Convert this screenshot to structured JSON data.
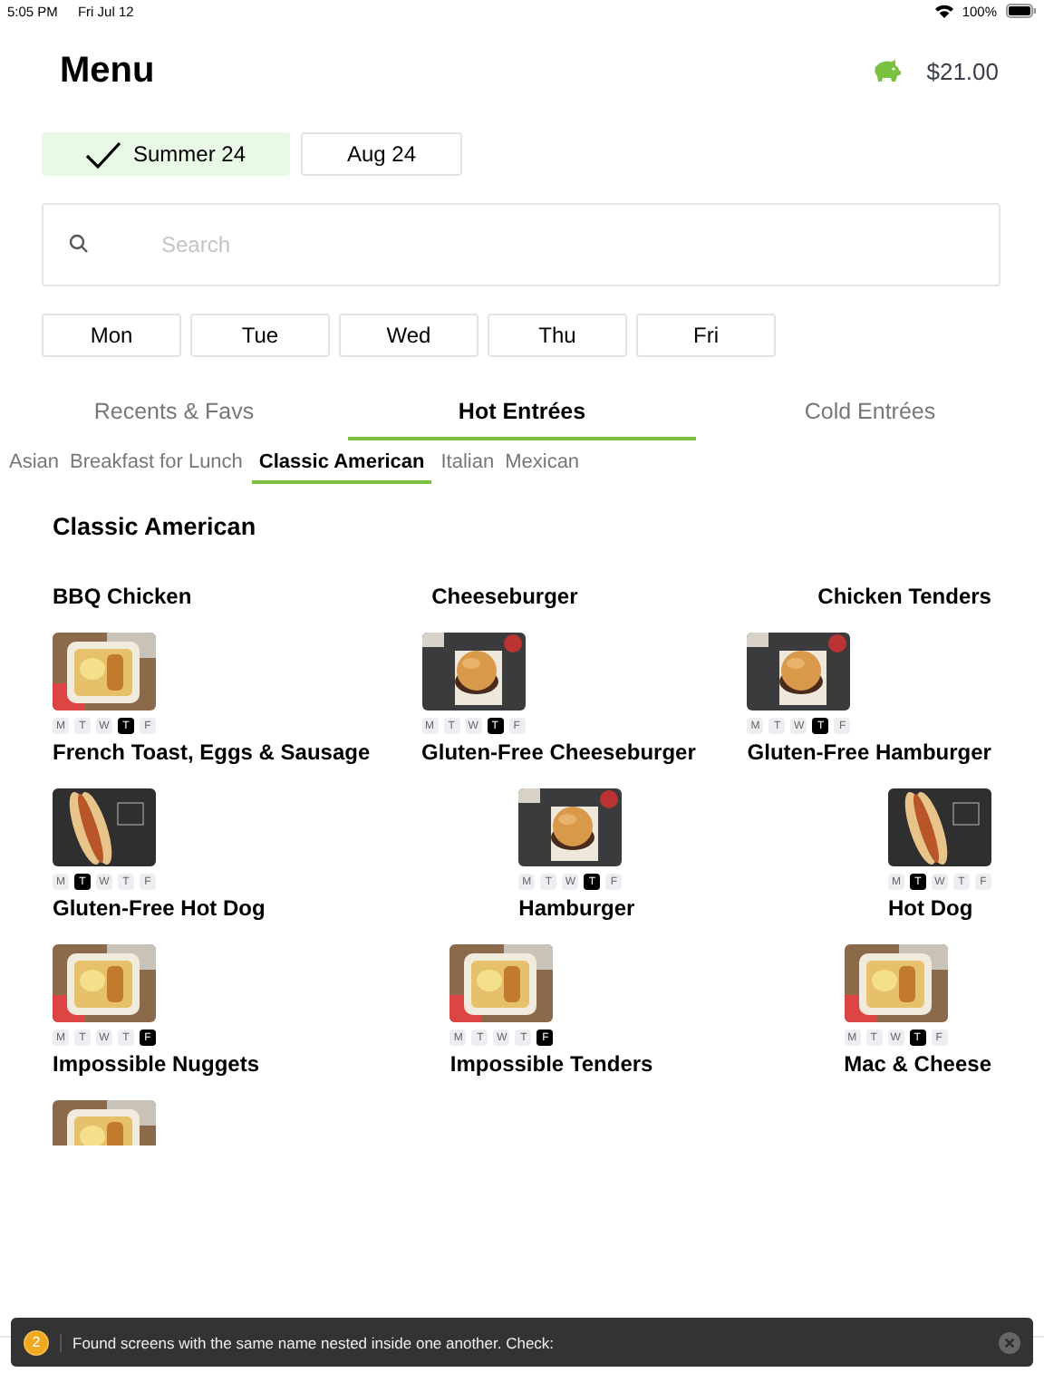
{
  "status_bar": {
    "time": "5:05 PM",
    "date": "Fri Jul 12",
    "battery": "100%"
  },
  "header": {
    "title": "Menu",
    "balance": "$21.00"
  },
  "terms": [
    {
      "label": "Summer 24",
      "selected": true
    },
    {
      "label": "Aug 24",
      "selected": false
    }
  ],
  "search": {
    "placeholder": "Search"
  },
  "days": [
    "Mon",
    "Tue",
    "Wed",
    "Thu",
    "Fri"
  ],
  "category_tabs": [
    {
      "label": "Recents & Favs",
      "selected": false
    },
    {
      "label": "Hot Entrées",
      "selected": true
    },
    {
      "label": "Cold Entrées",
      "selected": false
    }
  ],
  "subcategory_tabs": [
    {
      "label": "Asian",
      "selected": false
    },
    {
      "label": "Breakfast for Lunch",
      "selected": false
    },
    {
      "label": "Classic American",
      "selected": true
    },
    {
      "label": "Italian",
      "selected": false
    },
    {
      "label": "Mexican",
      "selected": false
    }
  ],
  "section": {
    "title": "Classic American",
    "rows": [
      [
        {
          "name": "BBQ Chicken",
          "photo": false
        },
        {
          "name": "Cheeseburger",
          "photo": false
        },
        {
          "name": "Chicken Tenders",
          "photo": false
        }
      ],
      [
        {
          "name": "French Toast, Eggs & Sausage",
          "photo": true,
          "days": [
            {
              "label": "M",
              "selected": false
            },
            {
              "label": "T",
              "selected": false
            },
            {
              "label": "W",
              "selected": false
            },
            {
              "label": "T",
              "selected": true
            },
            {
              "label": "F",
              "selected": false
            }
          ]
        },
        {
          "name": "Gluten-Free Cheeseburger",
          "photo": true,
          "days": [
            {
              "label": "M",
              "selected": false
            },
            {
              "label": "T",
              "selected": false
            },
            {
              "label": "W",
              "selected": false
            },
            {
              "label": "T",
              "selected": true
            },
            {
              "label": "F",
              "selected": false
            }
          ]
        },
        {
          "name": "Gluten-Free Hamburger",
          "photo": true,
          "days": [
            {
              "label": "M",
              "selected": false
            },
            {
              "label": "T",
              "selected": false
            },
            {
              "label": "W",
              "selected": false
            },
            {
              "label": "T",
              "selected": true
            },
            {
              "label": "F",
              "selected": false
            }
          ]
        }
      ],
      [
        {
          "name": "Gluten-Free Hot Dog",
          "photo": true,
          "days": [
            {
              "label": "M",
              "selected": false
            },
            {
              "label": "T",
              "selected": true
            },
            {
              "label": "W",
              "selected": false
            },
            {
              "label": "T",
              "selected": false
            },
            {
              "label": "F",
              "selected": false
            }
          ]
        },
        {
          "name": "Hamburger",
          "photo": true,
          "days": [
            {
              "label": "M",
              "selected": false
            },
            {
              "label": "T",
              "selected": false
            },
            {
              "label": "W",
              "selected": false
            },
            {
              "label": "T",
              "selected": true
            },
            {
              "label": "F",
              "selected": false
            }
          ]
        },
        {
          "name": "Hot Dog",
          "photo": true,
          "days": [
            {
              "label": "M",
              "selected": false
            },
            {
              "label": "T",
              "selected": true
            },
            {
              "label": "W",
              "selected": false
            },
            {
              "label": "T",
              "selected": false
            },
            {
              "label": "F",
              "selected": false
            }
          ]
        }
      ],
      [
        {
          "name": "Impossible Nuggets",
          "photo": true,
          "days": [
            {
              "label": "M",
              "selected": false
            },
            {
              "label": "T",
              "selected": false
            },
            {
              "label": "W",
              "selected": false
            },
            {
              "label": "T",
              "selected": false
            },
            {
              "label": "F",
              "selected": true
            }
          ]
        },
        {
          "name": "Impossible Tenders",
          "photo": true,
          "days": [
            {
              "label": "M",
              "selected": false
            },
            {
              "label": "T",
              "selected": false
            },
            {
              "label": "W",
              "selected": false
            },
            {
              "label": "T",
              "selected": false
            },
            {
              "label": "F",
              "selected": true
            }
          ]
        },
        {
          "name": "Mac & Cheese",
          "photo": true,
          "days": [
            {
              "label": "M",
              "selected": false
            },
            {
              "label": "T",
              "selected": false
            },
            {
              "label": "W",
              "selected": false
            },
            {
              "label": "T",
              "selected": true
            },
            {
              "label": "F",
              "selected": false
            }
          ]
        }
      ],
      [
        {
          "photo": true
        }
      ]
    ]
  },
  "toast": {
    "badge": "2",
    "message": "Found screens with the same name nested inside one another. Check:"
  }
}
